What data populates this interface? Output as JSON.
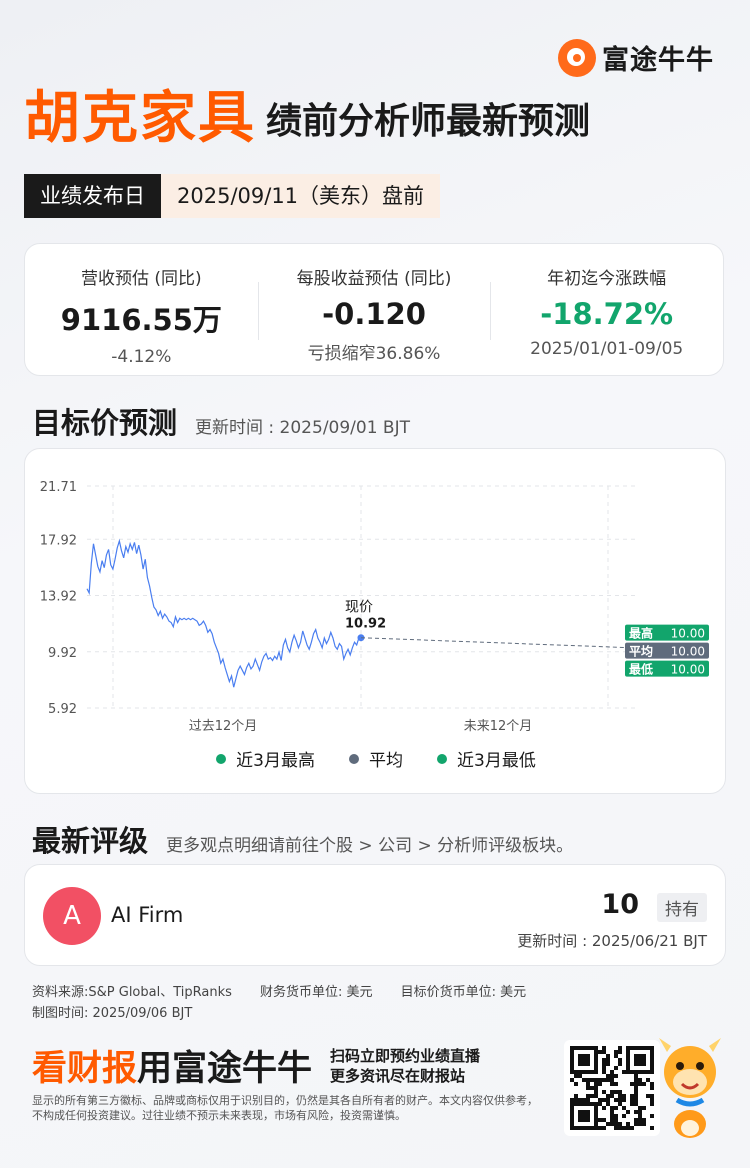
{
  "brand": {
    "logo_text": "富途牛牛"
  },
  "header": {
    "company": "胡克家具",
    "subtitle": "绩前分析师最新预测"
  },
  "release": {
    "label": "业绩发布日",
    "value": "2025/09/11（美东）盘前"
  },
  "stats": [
    {
      "label": "营收预估 (同比)",
      "value": "9116.55万",
      "sub": "-4.12%"
    },
    {
      "label": "每股收益预估 (同比)",
      "value": "-0.120",
      "sub": "亏损缩窄36.86%"
    },
    {
      "label": "年初迄今涨跌幅",
      "value": "-18.72%",
      "sub": "2025/01/01-09/05"
    }
  ],
  "target": {
    "title": "目标价预测",
    "updated": "更新时间 : 2025/09/01 BJT"
  },
  "chart_data": {
    "type": "line",
    "y_ticks": [
      "21.71",
      "17.92",
      "13.92",
      "9.92",
      "5.92"
    ],
    "ylim": [
      5.92,
      21.71
    ],
    "x_labels": [
      "过去12个月",
      "未来12个月"
    ],
    "current_label": "现价",
    "current_value": "10.92",
    "current_price": 10.92,
    "targets": [
      {
        "name": "最高",
        "value": "10.00",
        "color": "#12a56c"
      },
      {
        "name": "平均",
        "value": "10.00",
        "color": "#5f6b7c"
      },
      {
        "name": "最低",
        "value": "10.00",
        "color": "#12a56c"
      }
    ],
    "price_series": [
      14.4,
      14.1,
      16.2,
      17.6,
      16.8,
      16.0,
      15.6,
      16.4,
      15.9,
      16.8,
      17.2,
      16.1,
      15.8,
      16.5,
      17.3,
      17.8,
      17.1,
      16.6,
      17.4,
      17.0,
      17.6,
      17.2,
      17.7,
      16.9,
      17.5,
      16.8,
      15.8,
      16.5,
      15.2,
      14.6,
      13.8,
      13.1,
      12.9,
      12.5,
      12.8,
      12.3,
      12.6,
      12.4,
      12.1,
      12.0,
      11.7,
      12.4,
      12.0,
      12.3,
      12.2,
      12.3,
      12.2,
      12.3,
      12.2,
      12.3,
      12.2,
      12.1,
      11.8,
      11.9,
      12.1,
      11.8,
      11.3,
      11.5,
      11.2,
      10.6,
      10.2,
      9.8,
      9.1,
      9.4,
      8.8,
      8.3,
      7.8,
      8.2,
      7.4,
      8.0,
      8.6,
      8.9,
      8.6,
      8.3,
      8.8,
      9.1,
      8.7,
      8.9,
      9.4,
      9.0,
      8.6,
      9.2,
      9.6,
      9.8,
      9.4,
      9.5,
      9.3,
      9.6,
      9.4,
      9.9,
      9.3,
      10.4,
      10.8,
      10.2,
      9.9,
      10.6,
      11.1,
      10.7,
      10.2,
      10.6,
      11.4,
      10.9,
      10.4,
      10.1,
      10.6,
      11.2,
      11.5,
      10.9,
      10.6,
      10.2,
      10.9,
      10.5,
      10.8,
      11.3,
      10.9,
      10.3,
      10.1,
      10.5,
      10.3,
      9.4,
      9.8,
      10.1,
      9.7,
      10.2,
      10.6,
      10.4,
      10.9,
      10.92
    ],
    "legend": [
      {
        "name": "近3月最高",
        "color": "#12a56c"
      },
      {
        "name": "平均",
        "color": "#5f6b7c"
      },
      {
        "name": "近3月最低",
        "color": "#12a56c"
      }
    ]
  },
  "rating": {
    "title": "最新评级",
    "note": "更多观点明细请前往个股 > 公司 > 分析师评级板块。",
    "avatar_letter": "A",
    "firm": "AI Firm",
    "value": "10",
    "tag": "持有",
    "updated": "更新时间 : 2025/06/21 BJT"
  },
  "footer": {
    "source": "资料来源:S&P Global、TipRanks",
    "currency": "财务货币单位: 美元",
    "target_currency": "目标价货币单位: 美元",
    "made": "制图时间: 2025/09/06 BJT"
  },
  "promo": {
    "big1": "看财报",
    "big2": "用富途牛牛",
    "line1": "扫码立即预约业绩直播",
    "line2": "更多资讯尽在财报站",
    "disclaimer": "显示的所有第三方徽标、品牌或商标仅用于识别目的，仍然是其各自所有者的财产。本文内容仅供参考，不构成任何投资建议。过往业绩不预示未来表现，市场有风险，投资需谨慎。"
  }
}
